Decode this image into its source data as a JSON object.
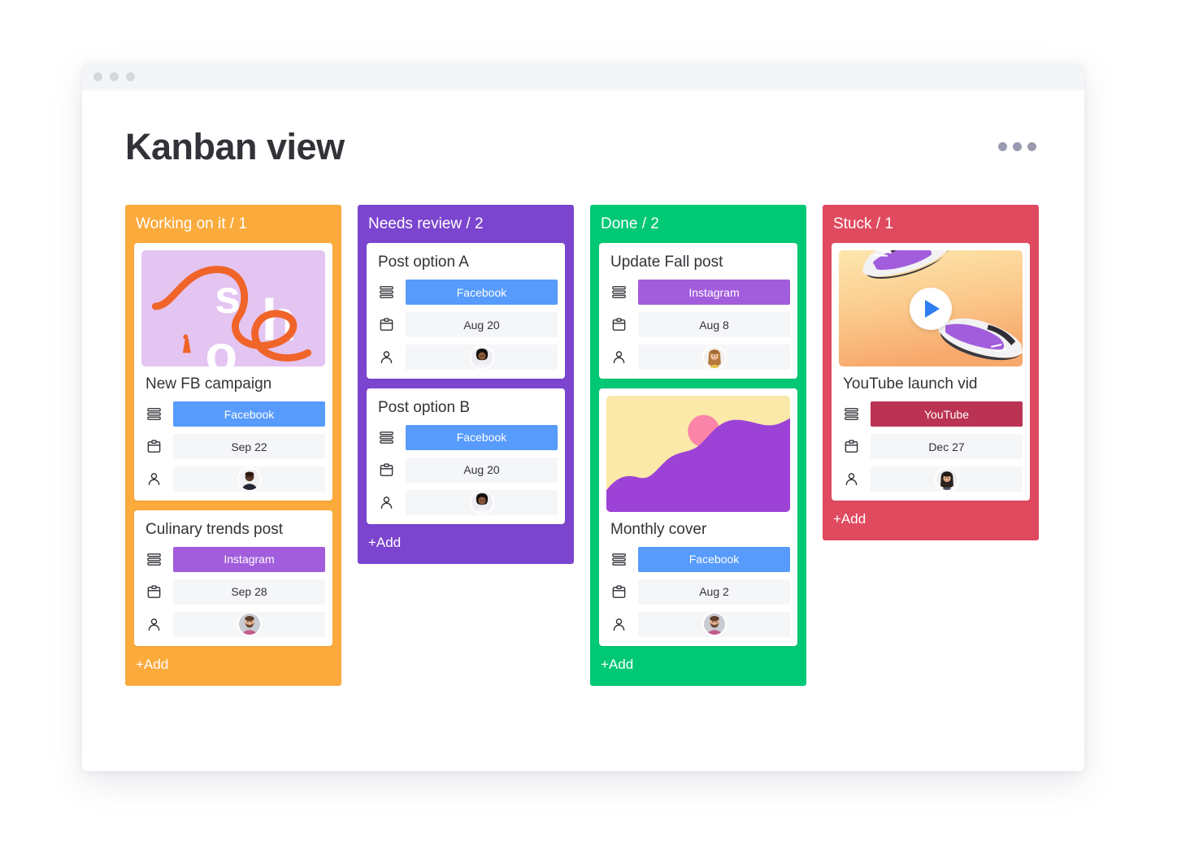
{
  "window": {
    "traffic_lights": [
      "close-dot",
      "minimize-dot",
      "maximize-dot"
    ]
  },
  "header": {
    "title": "Kanban view",
    "menu_icon": "kebab-menu-icon"
  },
  "row_icons": {
    "status": "status-bars-icon",
    "date": "calendar-icon",
    "person": "person-icon"
  },
  "colors": {
    "working_on_it": "#FBAA3C",
    "needs_review": "#7B45CF",
    "done": "#00C875",
    "stuck": "#E04A5F",
    "facebook": "#579BFC",
    "instagram": "#A25DDC",
    "youtube": "#BB3354",
    "cell_bg": "#F5F6F8",
    "text": "#323338"
  },
  "columns": [
    {
      "id": "working-on-it",
      "title": "Working on it / 1",
      "accent": "#FBAA3C",
      "add_label": "+Add",
      "cards": [
        {
          "id": "new-fb-campaign",
          "title": "New FB campaign",
          "media": "shop-lettering-illustration",
          "status": {
            "label": "Facebook",
            "color": "#579BFC"
          },
          "date": "Sep 22",
          "person": "avatar-dark-male"
        },
        {
          "id": "culinary-trends-post",
          "title": "Culinary trends post",
          "media": null,
          "status": {
            "label": "Instagram",
            "color": "#A25DDC"
          },
          "date": "Sep 28",
          "person": "avatar-bearded-male"
        }
      ]
    },
    {
      "id": "needs-review",
      "title": "Needs review / 2",
      "accent": "#7B45CF",
      "add_label": "+Add",
      "cards": [
        {
          "id": "post-option-a",
          "title": "Post option A",
          "media": null,
          "status": {
            "label": "Facebook",
            "color": "#579BFC"
          },
          "date": "Aug 20",
          "person": "avatar-curly-hair-woman"
        },
        {
          "id": "post-option-b",
          "title": "Post option B",
          "media": null,
          "status": {
            "label": "Facebook",
            "color": "#579BFC"
          },
          "date": "Aug 20",
          "person": "avatar-curly-hair-woman"
        }
      ]
    },
    {
      "id": "done",
      "title": "Done / 2",
      "accent": "#00C875",
      "add_label": "+Add",
      "cards": [
        {
          "id": "update-fall-post",
          "title": "Update Fall post",
          "media": null,
          "status": {
            "label": "Instagram",
            "color": "#A25DDC"
          },
          "date": "Aug 8",
          "person": "avatar-blonde-woman"
        },
        {
          "id": "monthly-cover",
          "title": "Monthly cover",
          "media": "purple-wave-sun-illustration",
          "status": {
            "label": "Facebook",
            "color": "#579BFC"
          },
          "date": "Aug 2",
          "person": "avatar-bearded-male"
        }
      ]
    },
    {
      "id": "stuck",
      "title": "Stuck / 1",
      "accent": "#E04A5F",
      "add_label": "+Add",
      "cards": [
        {
          "id": "youtube-launch-vid",
          "title": "YouTube launch vid",
          "media": "sneakers-video-thumbnail",
          "status": {
            "label": "YouTube",
            "color": "#BB3354"
          },
          "date": "Dec 27",
          "person": "avatar-dark-hair-woman"
        }
      ]
    }
  ]
}
